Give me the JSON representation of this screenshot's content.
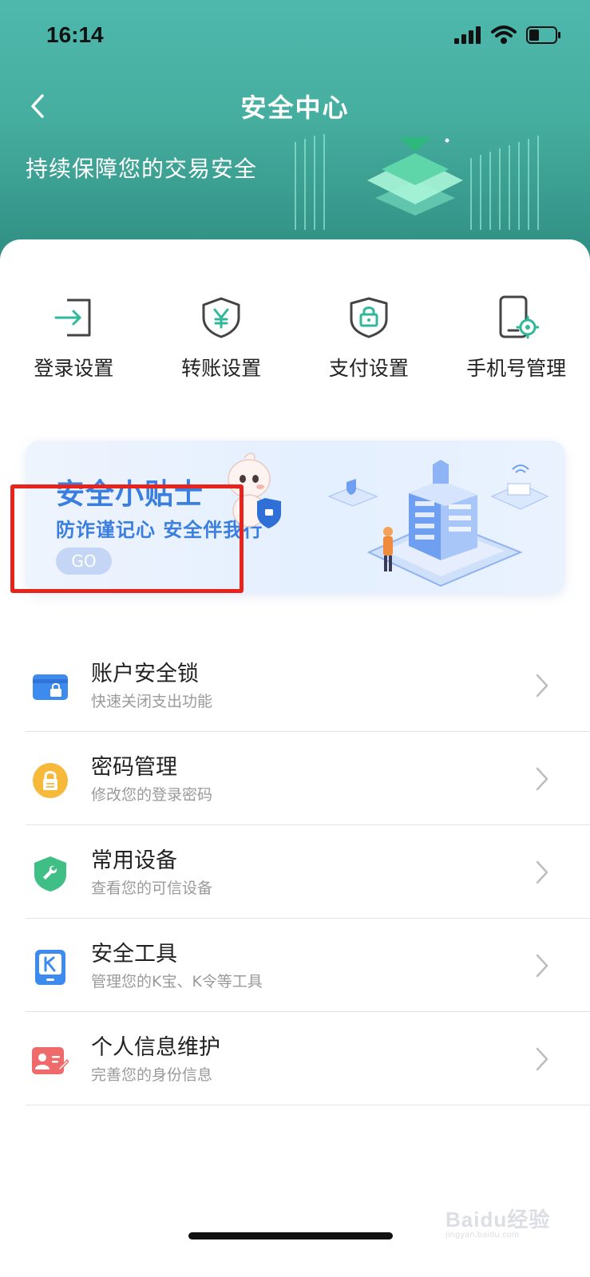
{
  "status_bar": {
    "time": "16:14"
  },
  "nav": {
    "title": "安全中心"
  },
  "banner": {
    "subtitle": "持续保障您的交易安全"
  },
  "quick_actions": [
    {
      "label": "登录设置",
      "icon": "login-icon"
    },
    {
      "label": "转账设置",
      "icon": "yuan-shield-icon"
    },
    {
      "label": "支付设置",
      "icon": "lock-shield-icon"
    },
    {
      "label": "手机号管理",
      "icon": "phone-gear-icon"
    }
  ],
  "tips": {
    "title": "安全小贴士",
    "subtitle": "防诈谨记心 安全伴我行",
    "go_label": "GO"
  },
  "menu": [
    {
      "title": "账户安全锁",
      "desc": "快速关闭支出功能",
      "icon": "card-lock-icon",
      "color": "#3d8bef"
    },
    {
      "title": "密码管理",
      "desc": "修改您的登录密码",
      "icon": "padlock-icon",
      "color": "#f6b93a"
    },
    {
      "title": "常用设备",
      "desc": "查看您的可信设备",
      "icon": "wrench-shield-icon",
      "color": "#3fbf86"
    },
    {
      "title": "安全工具",
      "desc": "管理您的K宝、K令等工具",
      "icon": "k-token-icon",
      "color": "#3d8bef"
    },
    {
      "title": "个人信息维护",
      "desc": "完善您的身份信息",
      "icon": "id-card-icon",
      "color": "#ef6b6b"
    }
  ],
  "colors": {
    "header_teal": "#4fb8ad",
    "accent_blue": "#3a7ee0",
    "highlight_red": "#e8231c"
  },
  "watermark": {
    "brand": "Baidu经验",
    "site": "jingyan.baidu.com"
  }
}
